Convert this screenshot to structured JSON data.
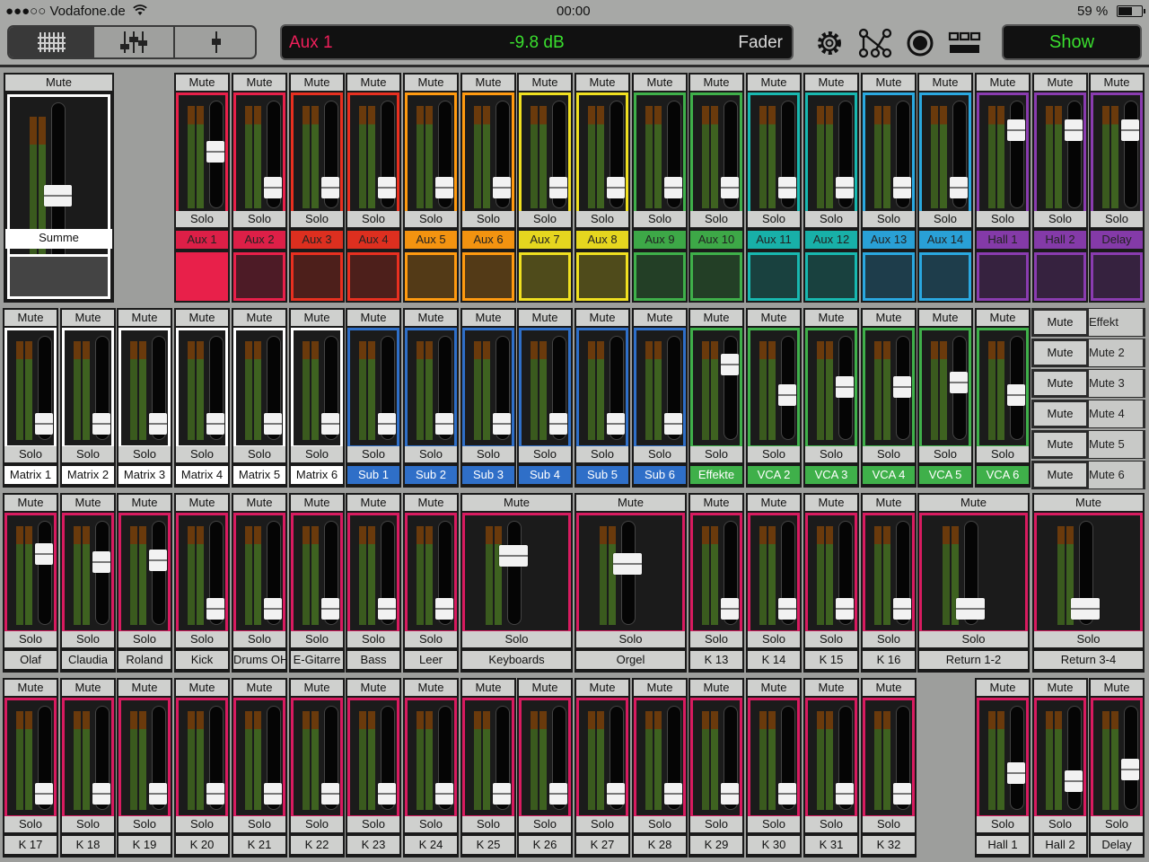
{
  "status": {
    "carrier": "●●●○○ Vodafone.de",
    "time": "00:00",
    "battery": "59 %"
  },
  "display": {
    "channel": "Aux 1",
    "value": "-9.8 dB",
    "mode": "Fader"
  },
  "show_label": "Show",
  "labels": {
    "mute": "Mute",
    "solo": "Solo"
  },
  "colors": {
    "red": "#e8204a",
    "magenta": "#d81b60",
    "white": "#ffffff",
    "orange": "#ff8a10",
    "yellow": "#f0e020",
    "green": "#3fb04a",
    "teal": "#18b8b0",
    "blue": "#2aa8e0",
    "purple": "#8a3cb0",
    "navy": "#2f6fc8"
  },
  "summe": {
    "name": "Summe",
    "level": 0.43
  },
  "mute_groups": [
    {
      "mute": "Mute",
      "name": "Effekt"
    },
    {
      "mute": "Mute",
      "name": "Mute 2"
    },
    {
      "mute": "Mute",
      "name": "Mute 3"
    },
    {
      "mute": "Mute",
      "name": "Mute 4"
    },
    {
      "mute": "Mute",
      "name": "Mute 5"
    },
    {
      "mute": "Mute",
      "name": "Mute 6"
    }
  ],
  "aux_channels": [
    {
      "name": "Aux 1",
      "color": "#e8204a",
      "level": 0.52,
      "selected": true
    },
    {
      "name": "Aux 2",
      "color": "#e8204a",
      "level": 0.1
    },
    {
      "name": "Aux 3",
      "color": "#e83020",
      "level": 0.1
    },
    {
      "name": "Aux 4",
      "color": "#e83020",
      "level": 0.1
    },
    {
      "name": "Aux 5",
      "color": "#ff9a10",
      "level": 0.1
    },
    {
      "name": "Aux 6",
      "color": "#ff9a10",
      "level": 0.1
    },
    {
      "name": "Aux 7",
      "color": "#f0e020",
      "level": 0.1
    },
    {
      "name": "Aux 8",
      "color": "#f0e020",
      "level": 0.1
    },
    {
      "name": "Aux 9",
      "color": "#3fb04a",
      "level": 0.1
    },
    {
      "name": "Aux 10",
      "color": "#3fb04a",
      "level": 0.1
    },
    {
      "name": "Aux 11",
      "color": "#18b8b0",
      "level": 0.1
    },
    {
      "name": "Aux 12",
      "color": "#18b8b0",
      "level": 0.1
    },
    {
      "name": "Aux 13",
      "color": "#2aa8e0",
      "level": 0.1
    },
    {
      "name": "Aux 14",
      "color": "#2aa8e0",
      "level": 0.1
    },
    {
      "name": "Hall 1",
      "color": "#8a3cb0",
      "level": 0.78
    },
    {
      "name": "Hall 2",
      "color": "#8a3cb0",
      "level": 0.78
    },
    {
      "name": "Delay",
      "color": "#8a3cb0",
      "level": 0.78
    }
  ],
  "row2_channels": [
    {
      "name": "Matrix 1",
      "color": "#ffffff",
      "level": 0.05
    },
    {
      "name": "Matrix 2",
      "color": "#ffffff",
      "level": 0.05
    },
    {
      "name": "Matrix 3",
      "color": "#ffffff",
      "level": 0.05
    },
    {
      "name": "Matrix 4",
      "color": "#ffffff",
      "level": 0.05
    },
    {
      "name": "Matrix 5",
      "color": "#ffffff",
      "level": 0.05
    },
    {
      "name": "Matrix 6",
      "color": "#ffffff",
      "level": 0.05
    },
    {
      "name": "Sub 1",
      "color": "#2f6fc8",
      "level": 0.05
    },
    {
      "name": "Sub 2",
      "color": "#2f6fc8",
      "level": 0.05
    },
    {
      "name": "Sub 3",
      "color": "#2f6fc8",
      "level": 0.05
    },
    {
      "name": "Sub 4",
      "color": "#2f6fc8",
      "level": 0.05
    },
    {
      "name": "Sub 5",
      "color": "#2f6fc8",
      "level": 0.05
    },
    {
      "name": "Sub 6",
      "color": "#2f6fc8",
      "level": 0.05
    },
    {
      "name": "Effekte",
      "color": "#3fb04a",
      "level": 0.78
    },
    {
      "name": "VCA 2",
      "color": "#3fb04a",
      "level": 0.4
    },
    {
      "name": "VCA 3",
      "color": "#3fb04a",
      "level": 0.5
    },
    {
      "name": "VCA 4",
      "color": "#3fb04a",
      "level": 0.5
    },
    {
      "name": "VCA 5",
      "color": "#3fb04a",
      "level": 0.55
    },
    {
      "name": "VCA 6",
      "color": "#3fb04a",
      "level": 0.4
    }
  ],
  "row3_channels": [
    {
      "name": "Olaf",
      "level": 0.72
    },
    {
      "name": "Claudia",
      "level": 0.62
    },
    {
      "name": "Roland",
      "level": 0.64
    },
    {
      "name": "Kick",
      "level": 0.05
    },
    {
      "name": "Drums OH",
      "level": 0.05
    },
    {
      "name": "E-Gitarre",
      "level": 0.05
    },
    {
      "name": "Bass",
      "level": 0.05
    },
    {
      "name": "Leer",
      "level": 0.05
    },
    {
      "name": "Keyboards",
      "level": 0.7,
      "wide": true
    },
    {
      "name": "Orgel",
      "level": 0.6,
      "wide": true
    },
    {
      "name": "K 13",
      "level": 0.05
    },
    {
      "name": "K 14",
      "level": 0.05
    },
    {
      "name": "K 15",
      "level": 0.05
    },
    {
      "name": "K 16",
      "level": 0.05
    },
    {
      "name": "Return 1-2",
      "level": 0.05,
      "wide": true
    },
    {
      "name": "Return 3-4",
      "level": 0.05,
      "wide": true
    }
  ],
  "row4_channels": [
    {
      "name": "K 17",
      "level": 0.05
    },
    {
      "name": "K 18",
      "level": 0.05
    },
    {
      "name": "K 19",
      "level": 0.05
    },
    {
      "name": "K 20",
      "level": 0.05
    },
    {
      "name": "K 21",
      "level": 0.05
    },
    {
      "name": "K 22",
      "level": 0.05
    },
    {
      "name": "K 23",
      "level": 0.05
    },
    {
      "name": "K 24",
      "level": 0.05
    },
    {
      "name": "K 25",
      "level": 0.05
    },
    {
      "name": "K 26",
      "level": 0.05
    },
    {
      "name": "K 27",
      "level": 0.05
    },
    {
      "name": "K 28",
      "level": 0.05
    },
    {
      "name": "K 29",
      "level": 0.05
    },
    {
      "name": "K 30",
      "level": 0.05
    },
    {
      "name": "K 31",
      "level": 0.05
    },
    {
      "name": "K 32",
      "level": 0.05
    },
    {
      "name": "Hall 1",
      "level": 0.3,
      "gap_before": true
    },
    {
      "name": "Hall 2",
      "level": 0.2
    },
    {
      "name": "Delay",
      "level": 0.35
    }
  ]
}
